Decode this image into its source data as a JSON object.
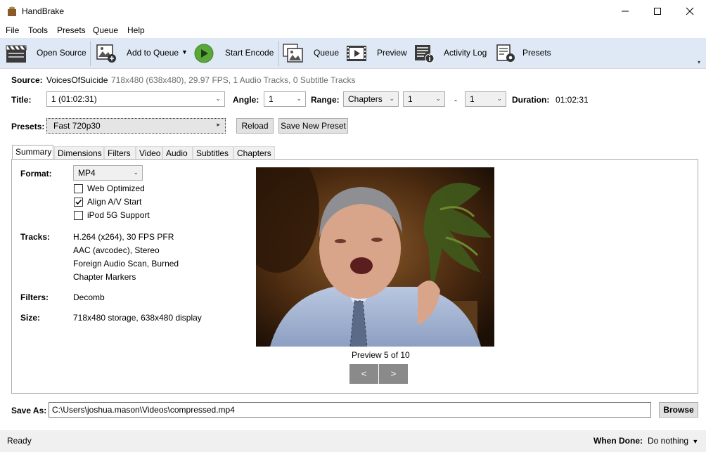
{
  "window": {
    "title": "HandBrake",
    "minimize_glyph": "—",
    "maximize_glyph": "☐",
    "close_glyph": "✕"
  },
  "menu": [
    "File",
    "Tools",
    "Presets",
    "Queue",
    "Help"
  ],
  "toolbar": {
    "open_source": "Open Source",
    "add_to_queue": "Add to Queue",
    "start_encode": "Start Encode",
    "queue": "Queue",
    "preview": "Preview",
    "activity_log": "Activity Log",
    "presets": "Presets",
    "accent_green": "#5aa83a"
  },
  "source": {
    "label": "Source:",
    "name": "VoicesOfSuicide",
    "details": "718x480 (638x480), 29.97 FPS, 1 Audio Tracks, 0 Subtitle Tracks"
  },
  "title_row": {
    "title_label": "Title:",
    "title_value": "1 (01:02:31)",
    "angle_label": "Angle:",
    "angle_value": "1",
    "range_label": "Range:",
    "range_mode": "Chapters",
    "range_start": "1",
    "range_dash": "-",
    "range_end": "1",
    "duration_label": "Duration:",
    "duration_value": "01:02:31"
  },
  "presets_row": {
    "label": "Presets:",
    "value": "Fast 720p30",
    "reload": "Reload",
    "save_new": "Save New Preset"
  },
  "tabs": [
    "Summary",
    "Dimensions",
    "Filters",
    "Video",
    "Audio",
    "Subtitles",
    "Chapters"
  ],
  "summary": {
    "format_label": "Format:",
    "format_value": "MP4",
    "options": [
      {
        "label": "Web Optimized",
        "checked": false
      },
      {
        "label": "Align A/V Start",
        "checked": true
      },
      {
        "label": "iPod 5G Support",
        "checked": false
      }
    ],
    "tracks_label": "Tracks:",
    "tracks": [
      "H.264 (x264), 30 FPS PFR",
      "AAC (avcodec), Stereo",
      "Foreign Audio Scan, Burned",
      "Chapter Markers"
    ],
    "filters_label": "Filters:",
    "filters_value": "Decomb",
    "size_label": "Size:",
    "size_value": "718x480 storage, 638x480 display",
    "preview_caption": "Preview 5 of 10",
    "prev_glyph": "<",
    "next_glyph": ">"
  },
  "save_as": {
    "label": "Save As:",
    "path": "C:\\Users\\joshua.mason\\Videos\\compressed.mp4",
    "browse": "Browse"
  },
  "status": {
    "text": "Ready",
    "when_done_label": "When Done:",
    "when_done_value": "Do nothing"
  }
}
